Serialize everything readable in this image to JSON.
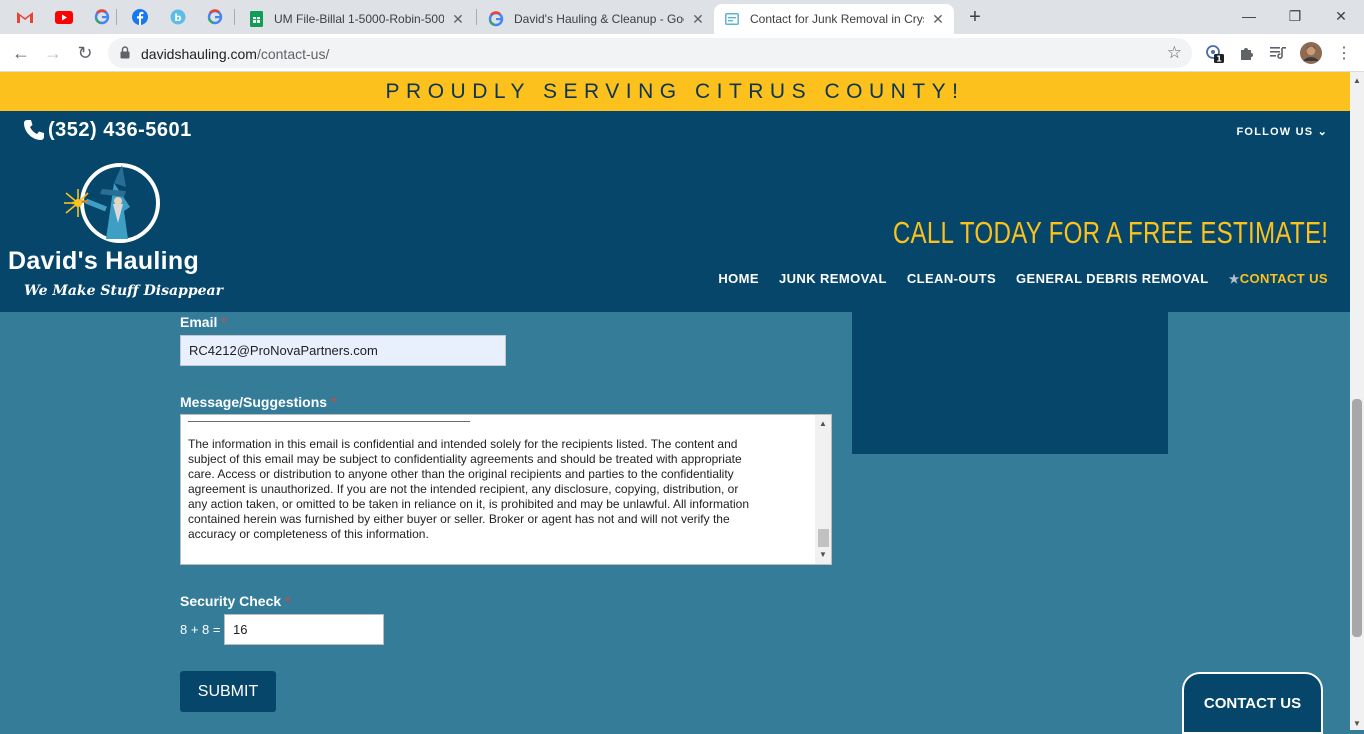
{
  "browser": {
    "pinned_tabs": [
      {
        "icon": "gmail-icon"
      },
      {
        "icon": "youtube-icon"
      },
      {
        "icon": "google-icon"
      },
      {
        "icon": "facebook-icon"
      },
      {
        "icon": "bitly-icon"
      },
      {
        "icon": "google-icon"
      }
    ],
    "tabs": [
      {
        "title": "UM File-Billal 1-5000-Robin-5001",
        "icon": "sheets-icon",
        "close": "✕"
      },
      {
        "title": "David's Hauling & Cleanup - Goo",
        "icon": "google-icon",
        "close": "✕"
      },
      {
        "title": "Contact for Junk Removal in Crys",
        "icon": "page-icon",
        "close": "✕",
        "active": true
      }
    ],
    "new_tab": "+",
    "window_controls": {
      "minimize": "—",
      "restore": "❐",
      "close": "✕"
    },
    "url_host": "davidshauling.com",
    "url_path": "/contact-us/",
    "extension_badge": "1"
  },
  "site": {
    "banner": "PROUDLY SERVING CITRUS COUNTY!",
    "phone": "(352) 436-5601",
    "follow_us": "FOLLOW US",
    "logo_name": "David's Hauling",
    "logo_tagline": "We Make Stuff Disappear",
    "cta": "CALL TODAY FOR A FREE ESTIMATE!",
    "nav": {
      "home": "HOME",
      "junk": "JUNK REMOVAL",
      "cleanouts": "CLEAN-OUTS",
      "debris": "GENERAL DEBRIS REMOVAL",
      "contact": "CONTACT US",
      "contact_star": "★"
    }
  },
  "form": {
    "email_label": "Email",
    "required_mark": "*",
    "email_value": "RC4212@ProNovaPartners.com",
    "message_label": "Message/Suggestions",
    "message_text": "The information in this email is confidential and intended solely for the recipients listed.  The content and\nsubject of this email may be subject to confidentiality agreements and should be treated with appropriate\ncare.  Access or distribution to anyone other than the original recipients and parties to the confidentiality\nagreement is unauthorized.  If you are not the intended recipient, any disclosure, copying, distribution, or\nany action taken, or omitted to be taken in reliance on it, is prohibited and may be unlawful.  All information\ncontained herein was furnished by either buyer or seller.  Broker or agent has not and will not verify the\naccuracy or completeness of this information.",
    "security_label": "Security Check",
    "security_question": "8 + 8 =",
    "security_answer": "16",
    "submit_label": "SUBMIT"
  },
  "contact_tab": "CONTACT US",
  "colors": {
    "banner": "#fcc11c",
    "header": "#05466a",
    "content": "#357c99",
    "accent": "#fcc11c"
  }
}
